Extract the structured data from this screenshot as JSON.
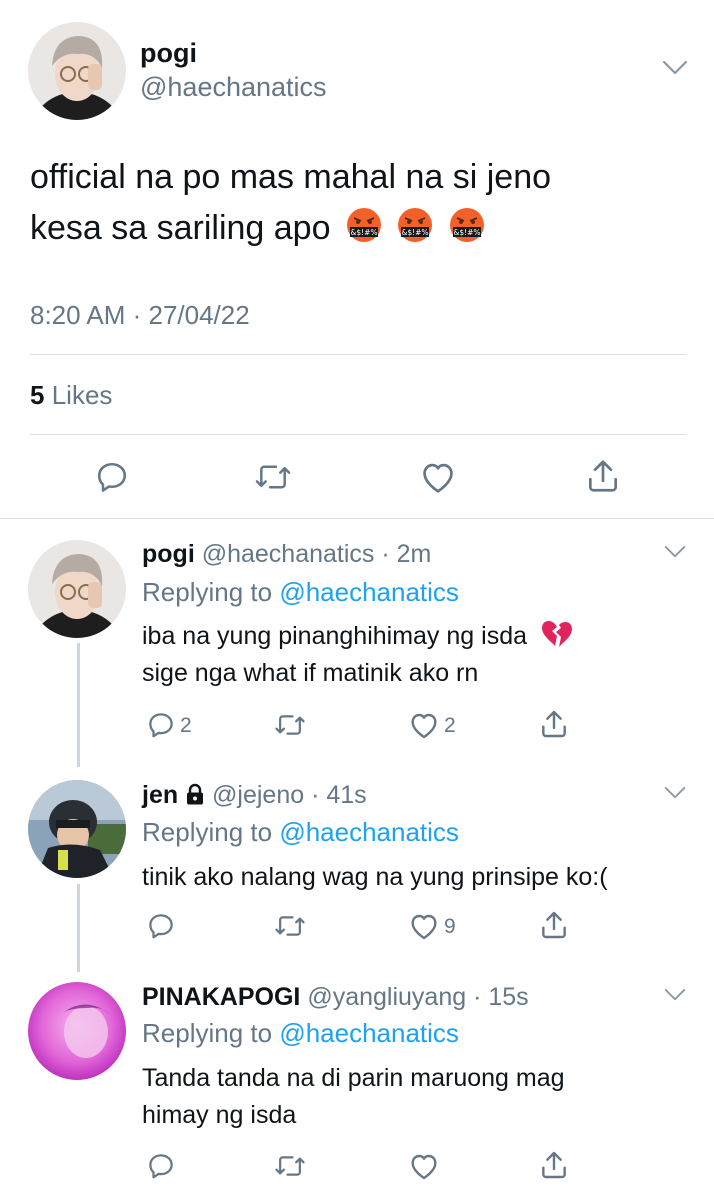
{
  "main_tweet": {
    "name": "pogi",
    "handle": "@haechanatics",
    "text_line1": "official na po mas mahal na si jeno",
    "text_line2": "kesa sa sariling apo",
    "emoji_text": "&$!#%",
    "timestamp": "8:20 AM · 27/04/22",
    "likes_count": "5",
    "likes_label": "Likes"
  },
  "replies": [
    {
      "name": "pogi",
      "handle": "@haechanatics",
      "time": "2m",
      "replying_prefix": "Replying to",
      "replying_to": "@haechanatics",
      "text_line1": "iba na yung pinanghihimay ng isda",
      "text_line2": "sige nga what if matinik ako rn",
      "reply_count": "2",
      "like_count": "2"
    },
    {
      "name": "jen",
      "handle": "@jejeno",
      "time": "41s",
      "replying_prefix": "Replying to",
      "replying_to": "@haechanatics",
      "text_line1": "tinik ako nalang wag na yung prinsipe ko:(",
      "like_count": "9"
    },
    {
      "name": "PINAKAPOGI",
      "handle": "@yangliuyang",
      "time": "15s",
      "replying_prefix": "Replying to",
      "replying_to": "@haechanatics",
      "text_line1": "Tanda tanda na di parin maruong mag",
      "text_line2": "himay ng isda"
    }
  ],
  "colors": {
    "accent": "#1da1f2",
    "secondary_text": "#657786",
    "divider": "#dcdfe3",
    "heart_break": "#e0245e"
  }
}
